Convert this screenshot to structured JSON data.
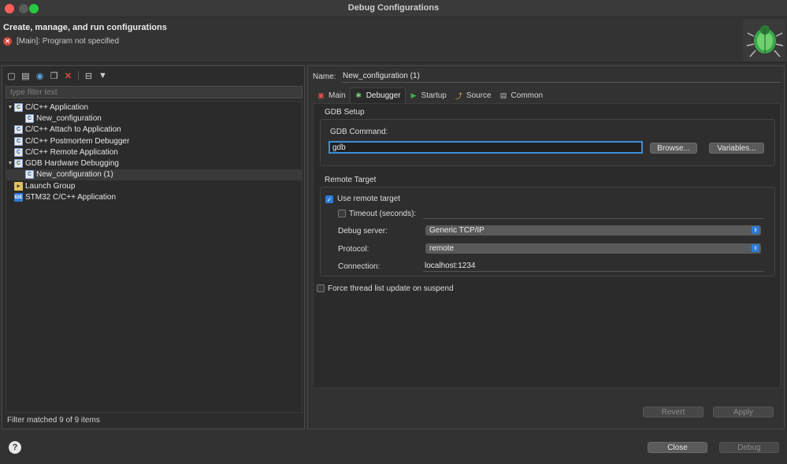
{
  "window": {
    "title": "Debug Configurations"
  },
  "header": {
    "title": "Create, manage, and run configurations",
    "error_message": "[Main]: Program not specified"
  },
  "left": {
    "filter_placeholder": "type filter text",
    "toolbar": [
      "new-config-icon",
      "duplicate-icon",
      "export-icon",
      "copy-icon",
      "delete-icon",
      "collapse-all-icon",
      "filter-icon"
    ],
    "tree": [
      {
        "label": "C/C++ Application",
        "level": 0,
        "expanded": true,
        "icon": "C"
      },
      {
        "label": "New_configuration",
        "level": 1,
        "icon": "C"
      },
      {
        "label": "C/C++ Attach to Application",
        "level": 0,
        "icon": "C"
      },
      {
        "label": "C/C++ Postmortem Debugger",
        "level": 0,
        "icon": "C"
      },
      {
        "label": "C/C++ Remote Application",
        "level": 0,
        "icon": "C"
      },
      {
        "label": "GDB Hardware Debugging",
        "level": 0,
        "expanded": true,
        "icon": "C"
      },
      {
        "label": "New_configuration (1)",
        "level": 1,
        "icon": "C",
        "selected": true
      },
      {
        "label": "Launch Group",
        "level": 0,
        "icon": "launch"
      },
      {
        "label": "STM32 C/C++ Application",
        "level": 0,
        "icon": "IDE"
      }
    ],
    "filter_status": "Filter matched 9 of 9 items"
  },
  "right": {
    "name_label": "Name:",
    "name_value": "New_configuration (1)",
    "tabs": [
      {
        "label": "Main",
        "icon": "main-tab-icon",
        "active": false
      },
      {
        "label": "Debugger",
        "icon": "debugger-tab-icon",
        "active": true
      },
      {
        "label": "Startup",
        "icon": "startup-tab-icon",
        "active": false
      },
      {
        "label": "Source",
        "icon": "source-tab-icon",
        "active": false
      },
      {
        "label": "Common",
        "icon": "common-tab-icon",
        "active": false
      }
    ],
    "gdb_setup": {
      "group_label": "GDB Setup",
      "command_label": "GDB Command:",
      "command_value": "gdb",
      "browse_label": "Browse...",
      "variables_label": "Variables..."
    },
    "remote_target": {
      "group_label": "Remote Target",
      "use_remote_label": "Use remote target",
      "use_remote_checked": true,
      "timeout_label": "Timeout (seconds):",
      "timeout_checked": false,
      "timeout_value": "",
      "debug_server_label": "Debug server:",
      "debug_server_value": "Generic TCP/IP",
      "protocol_label": "Protocol:",
      "protocol_value": "remote",
      "connection_label": "Connection:",
      "connection_value": "localhost:1234"
    },
    "force_thread_label": "Force thread list update on suspend",
    "force_thread_checked": false,
    "revert_label": "Revert",
    "apply_label": "Apply"
  },
  "footer": {
    "close_label": "Close",
    "debug_label": "Debug"
  },
  "colors": {
    "accent": "#2d7bd6",
    "error": "#d0443a"
  }
}
